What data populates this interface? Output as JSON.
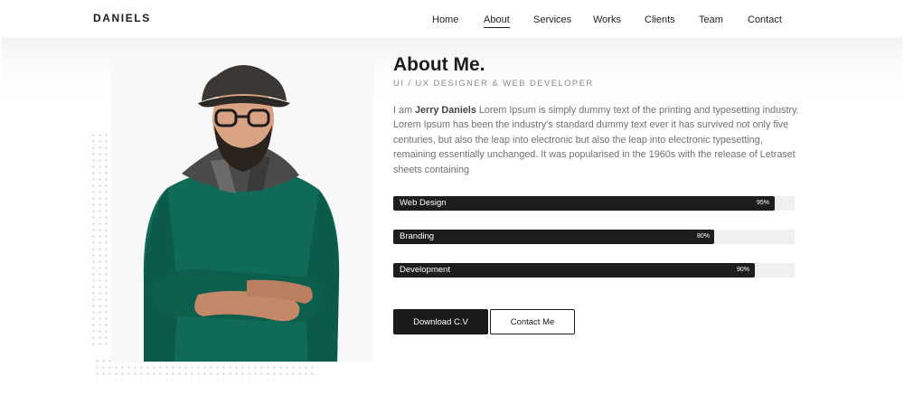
{
  "nav": {
    "brand": "DANIELS",
    "items": [
      {
        "label": "Home"
      },
      {
        "label": "About"
      },
      {
        "label": "Services"
      },
      {
        "label": "Works"
      },
      {
        "label": "Clients"
      },
      {
        "label": "Team"
      },
      {
        "label": "Contact"
      }
    ]
  },
  "about": {
    "title": "About Me.",
    "subtitle": "UI / UX DESIGNER & WEB DEVELOPER",
    "bio_prefix": "I am ",
    "bio_name": "Jerry Daniels",
    "bio_text": " Lorem Ipsum is simply dummy text of the printing and typesetting industry. Lorem Ipsum has been the industry's standard dummy text ever it has survived not only five centuries, but also the leap into electronic but also the leap into electronic typesetting, remaining essentially unchanged. It was popularised in the 1960s with the release of Letraset sheets containing"
  },
  "skills": [
    {
      "name": "Web Design",
      "percent_label": "95%",
      "value": 95
    },
    {
      "name": "Branding",
      "percent_label": "80%",
      "value": 80
    },
    {
      "name": "Development",
      "percent_label": "90%",
      "value": 90
    }
  ],
  "buttons": {
    "download": "Download C.V",
    "contact": "Contact Me"
  },
  "photo": {
    "icon": "person-portrait"
  },
  "colors": {
    "accent": "#1b1b1b",
    "track": "#efefef",
    "muted_text": "#707070"
  }
}
